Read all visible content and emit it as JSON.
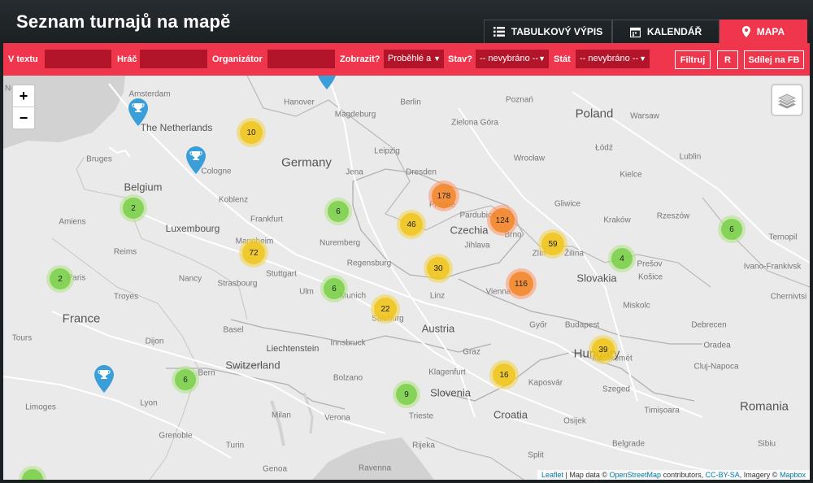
{
  "header": {
    "title": "Seznam turnajů na mapě"
  },
  "tabs": [
    {
      "label": "TABULKOVÝ VÝPIS",
      "icon": "list-icon"
    },
    {
      "label": "KALENDÁŘ",
      "icon": "calendar-icon"
    },
    {
      "label": "MAPA",
      "icon": "map-pin-icon",
      "active": true
    }
  ],
  "filters": {
    "text_label": "V textu",
    "text_value": "",
    "player_label": "Hráč",
    "player_value": "",
    "organizer_label": "Organizátor",
    "organizer_value": "",
    "show_label": "Zobrazit?",
    "show_value": "Proběhlé a",
    "status_label": "Stav?",
    "status_value": "-- nevybráno --",
    "country_label": "Stát",
    "country_value": "-- nevybráno --",
    "filter_button": "Filtruj",
    "reset_button": "R",
    "share_button": "Sdílej na FB"
  },
  "map": {
    "zoom_in": "+",
    "zoom_out": "−",
    "countries": [
      "Poland",
      "Germany",
      "Czechia",
      "Belgium",
      "France",
      "Slovakia",
      "Austria",
      "Switzerland",
      "Hungary",
      "Slovenia",
      "Croatia",
      "Romania",
      "Luxembourg",
      "The Netherlands",
      "Liechtenstein"
    ],
    "places": [
      "Amsterdam",
      "Norwich",
      "Hanover",
      "Berlin",
      "Poznań",
      "Warsaw",
      "Magdeburg",
      "Zielona Góra",
      "Bruges",
      "Cologne",
      "Leipzig",
      "Wrocław",
      "Łódź",
      "Lublin",
      "Dresden",
      "Jena",
      "Koblenz",
      "Frankfurt",
      "Prague",
      "Pardubice",
      "Kielce",
      "Gliwice",
      "Kraków",
      "Rzeszów",
      "Amiens",
      "Nuremberg",
      "Jihlava",
      "Brno",
      "Zlín",
      "Žilina",
      "Ternopil",
      "Reims",
      "Mannheim",
      "Stuttgart",
      "Regensburg",
      "Prešov",
      "Košice",
      "Ivano-Frankivsk",
      "Nancy",
      "Strasbourg",
      "Ulm",
      "Munich",
      "Linz",
      "Vienna",
      "Paris",
      "Troyes",
      "Chernivtsi",
      "Miskolc",
      "Salzburg",
      "Basel",
      "Innsbruck",
      "Győr",
      "Budapest",
      "Tours",
      "Dijon",
      "Debrecen",
      "Graz",
      "Kecskemét",
      "Oradea",
      "Bern",
      "Bolzano",
      "Klagenfurt",
      "Kaposvár",
      "Szeged",
      "Cluj-Napoca",
      "Lyon",
      "Milan",
      "Verona",
      "Trieste",
      "Limoges",
      "Turin",
      "Rijeka",
      "Osijek",
      "Timișoara",
      "Grenoble",
      "Genoa",
      "Ravenna",
      "Split",
      "Belgrade",
      "Sibiu"
    ],
    "clusters": [
      "10",
      "2",
      "6",
      "72",
      "178",
      "46",
      "124",
      "59",
      "4",
      "6",
      "2",
      "30",
      "116",
      "6",
      "22",
      "39",
      "16",
      "6",
      "9"
    ],
    "attribution": {
      "leaflet": "Leaflet",
      "map_data": "| Map data ©",
      "osm": "OpenStreetMap",
      "contributors": "contributors,",
      "license": "CC-BY-SA",
      "imagery": ", Imagery ©",
      "mapbox": "Mapbox"
    }
  }
}
